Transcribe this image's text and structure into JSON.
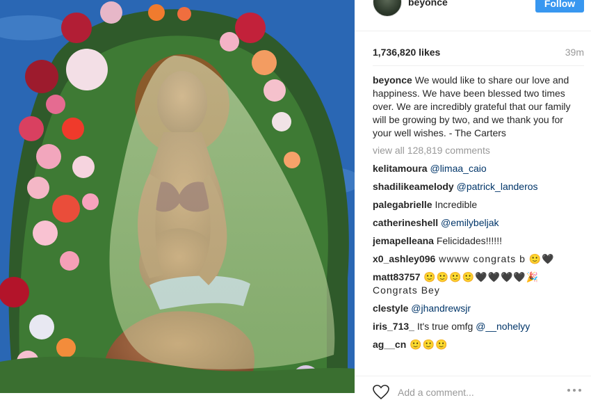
{
  "post": {
    "author": "beyonce",
    "follow_label": "Follow",
    "likes": "1,736,820 likes",
    "time_ago": "39m",
    "caption_user": "beyonce",
    "caption_text": " We would like to share our love and happiness. We have been blessed two times over. We are incredibly grateful that our family will be growing by two, and we thank you for your well wishes. - The Carters",
    "view_all": "view all 128,819 comments",
    "comments": [
      {
        "user": "kelitamoura",
        "text": "",
        "mention": "@limaa_caio"
      },
      {
        "user": "shadilikeamelody",
        "text": "",
        "mention": "@patrick_landeros"
      },
      {
        "user": "palegabrielle",
        "text": " Incredible",
        "mention": ""
      },
      {
        "user": "catherineshell",
        "text": "",
        "mention": "@emilybeljak"
      },
      {
        "user": "jemapelleana",
        "text": " Felicidades!!!!!!",
        "mention": ""
      },
      {
        "user": "x0_ashley096",
        "text": " wwww congrats b 🙂🖤",
        "mention": ""
      },
      {
        "user": "matt83757",
        "text": " 🙂🙂🙂🙂🖤🖤🖤🖤🎉 Congrats Bey",
        "mention": ""
      },
      {
        "user": "clestyle",
        "text": "",
        "mention": "@jhandrewsjr"
      },
      {
        "user": "iris_713_",
        "text": " It's true omfg ",
        "mention": "@__nohelyy"
      },
      {
        "user": "ag__cn",
        "text": " 🙂🙂🙂",
        "mention": ""
      }
    ],
    "add_comment_placeholder": "Add a comment..."
  },
  "icons": {
    "avatar": "profile-avatar",
    "like": "heart-icon",
    "more": "more-options-icon"
  },
  "colors": {
    "follow_button": "#3897f0",
    "mention": "#003569",
    "muted": "#999999",
    "text": "#262626"
  }
}
